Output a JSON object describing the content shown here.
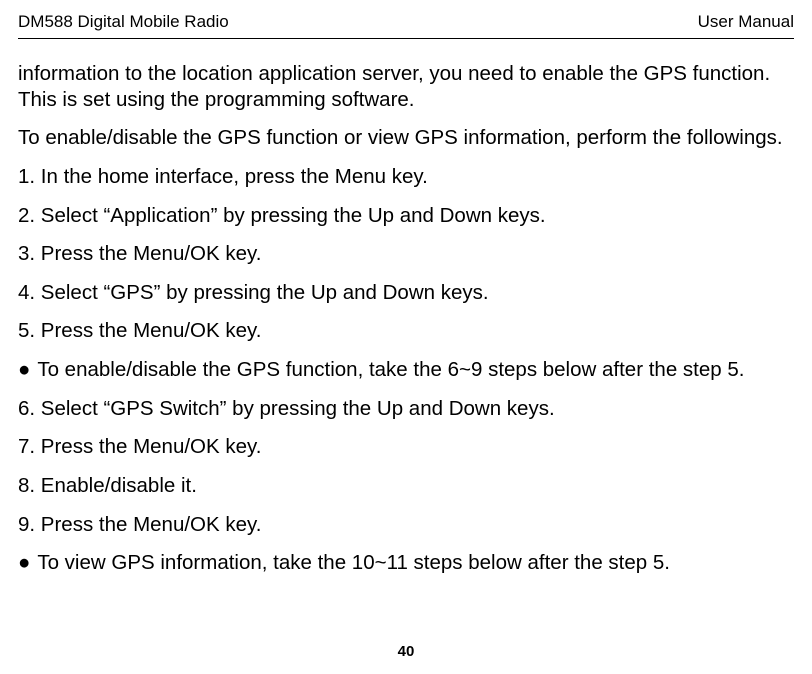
{
  "header": {
    "left": "DM588 Digital Mobile Radio",
    "right": "User Manual"
  },
  "body": {
    "p1": "information to the location application server, you need to enable the GPS function. This is set using the programming software.",
    "p2": "To enable/disable the GPS function or view GPS information, perform the followings.",
    "p3": "1. In the home interface, press the Menu key.",
    "p4": "2. Select “Application” by pressing the Up and Down keys.",
    "p5": "3. Press the Menu/OK key.",
    "p6": "4. Select “GPS” by pressing the Up and Down keys.",
    "p7": "5. Press the Menu/OK key.",
    "p8_bullet": "●",
    "p8_text": " To enable/disable the GPS function, take the 6~9 steps below after the step 5.",
    "p9": "6. Select “GPS Switch” by pressing the Up and Down keys.",
    "p10": "7. Press the Menu/OK key.",
    "p11": "8. Enable/disable it.",
    "p12": "9. Press the Menu/OK key.",
    "p13_bullet": "●",
    "p13_text": " To view GPS information, take the 10~11 steps below after the step 5."
  },
  "footer": {
    "page_number": "40"
  }
}
